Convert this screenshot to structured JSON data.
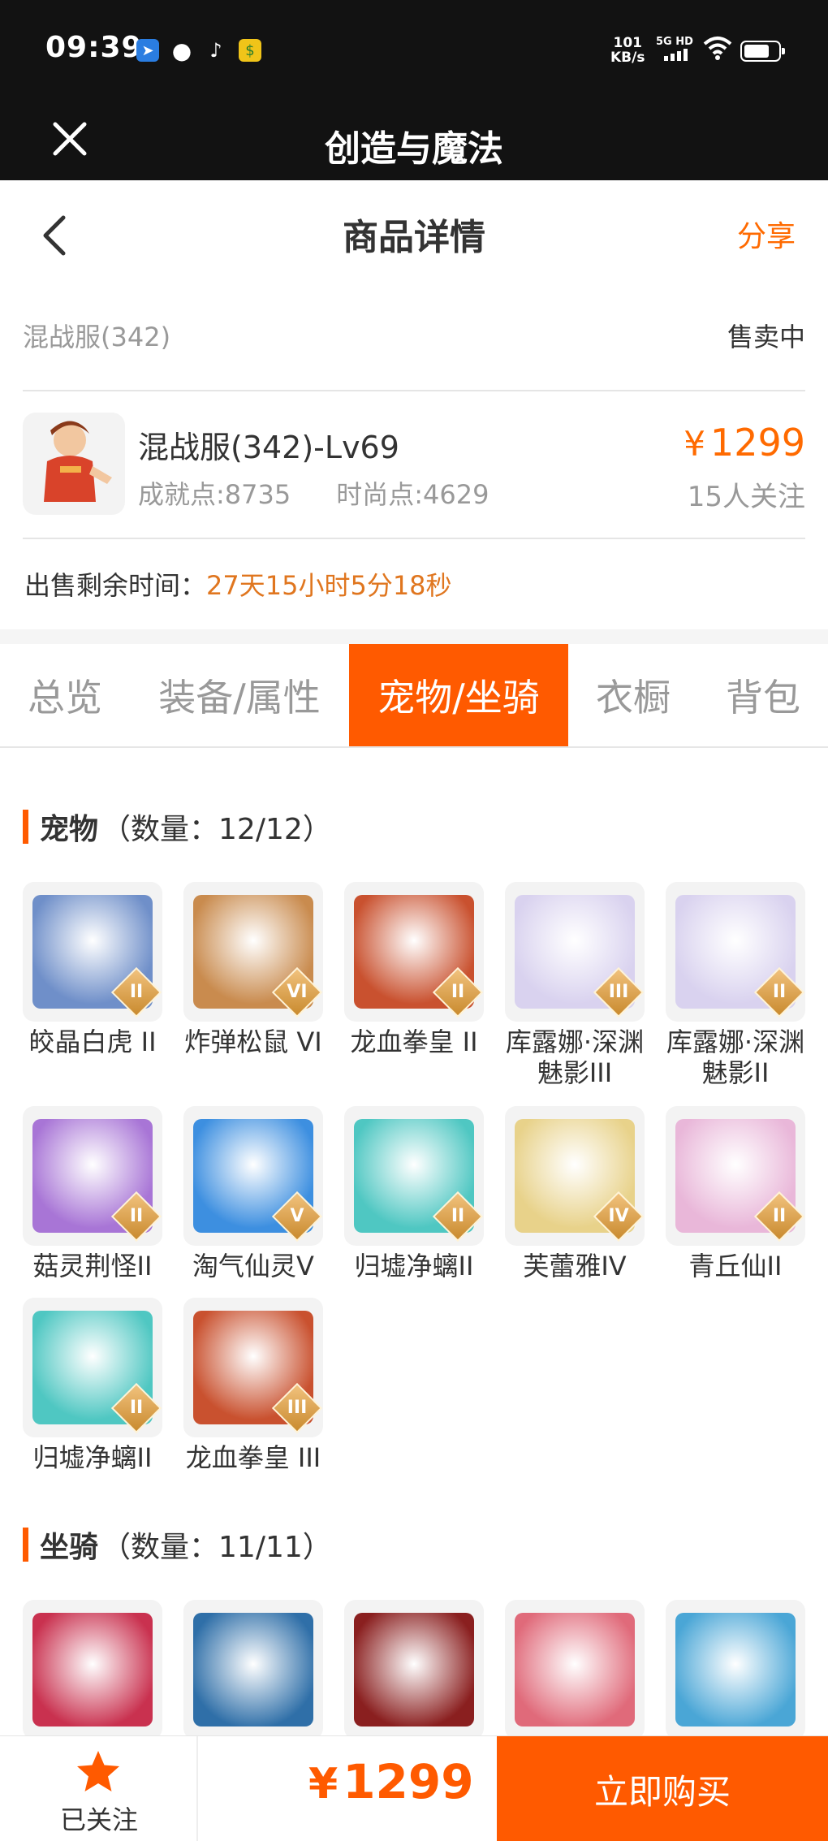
{
  "status_bar": {
    "time": "09:39",
    "net_speed": "101",
    "net_unit": "KB/s",
    "signal": "5G HD",
    "notif_icons": [
      "location-app-icon",
      "message-icon",
      "tiktok-icon",
      "money-app-icon"
    ]
  },
  "app_bar": {
    "title": "创造与魔法"
  },
  "header": {
    "title": "商品详情",
    "share": "分享"
  },
  "server": {
    "name": "混战服(342)",
    "status": "售卖中"
  },
  "product": {
    "name": "混战服(342)-Lv69",
    "achievement": "成就点:8735",
    "fashion": "时尚点:4629",
    "currency": "¥",
    "price": "1299",
    "followers": "15人关注"
  },
  "remaining": {
    "label": "出售剩余时间：",
    "value": "27天15小时5分18秒"
  },
  "tabs": [
    {
      "label": "总览"
    },
    {
      "label": "装备/属性"
    },
    {
      "label": "宠物/坐骑"
    },
    {
      "label": "衣橱"
    },
    {
      "label": "背包"
    }
  ],
  "active_tab": "宠物/坐骑",
  "pets_section": {
    "title": "宠物",
    "count": "（数量：12/12）"
  },
  "pets": [
    {
      "name": "皎晶白虎 II",
      "rank": "II",
      "color": "#6f8fc9"
    },
    {
      "name": "炸弹松鼠 VI",
      "rank": "VI",
      "color": "#c98b4e"
    },
    {
      "name": "龙血拳皇 II",
      "rank": "II",
      "color": "#c9512f"
    },
    {
      "name": "库露娜·深渊魅影III",
      "rank": "III",
      "color": "#d9d2ef"
    },
    {
      "name": "库露娜·深渊魅影II",
      "rank": "II",
      "color": "#d9d2ef"
    },
    {
      "name": "菇灵荆怪II",
      "rank": "II",
      "color": "#a875d6"
    },
    {
      "name": "淘气仙灵V",
      "rank": "V",
      "color": "#3d8fe0"
    },
    {
      "name": "归墟净螭II",
      "rank": "II",
      "color": "#4fc7c2"
    },
    {
      "name": "芙蕾雅IV",
      "rank": "IV",
      "color": "#e8d28a"
    },
    {
      "name": "青丘仙II",
      "rank": "II",
      "color": "#e9b7d9"
    },
    {
      "name": "归墟净螭II",
      "rank": "II",
      "color": "#4fc7c2"
    },
    {
      "name": "龙血拳皇 III",
      "rank": "III",
      "color": "#c9512f"
    }
  ],
  "mounts_section": {
    "title": "坐骑",
    "count": "（数量：11/11）"
  },
  "mounts": [
    {
      "color": "#c9314f"
    },
    {
      "color": "#2f6fa8"
    },
    {
      "color": "#8a1f1f"
    },
    {
      "color": "#e06a7a"
    },
    {
      "color": "#4aa6d6"
    }
  ],
  "bottom_bar": {
    "follow_label": "已关注",
    "currency": "¥",
    "price": "1299",
    "buy_label": "立即购买"
  }
}
